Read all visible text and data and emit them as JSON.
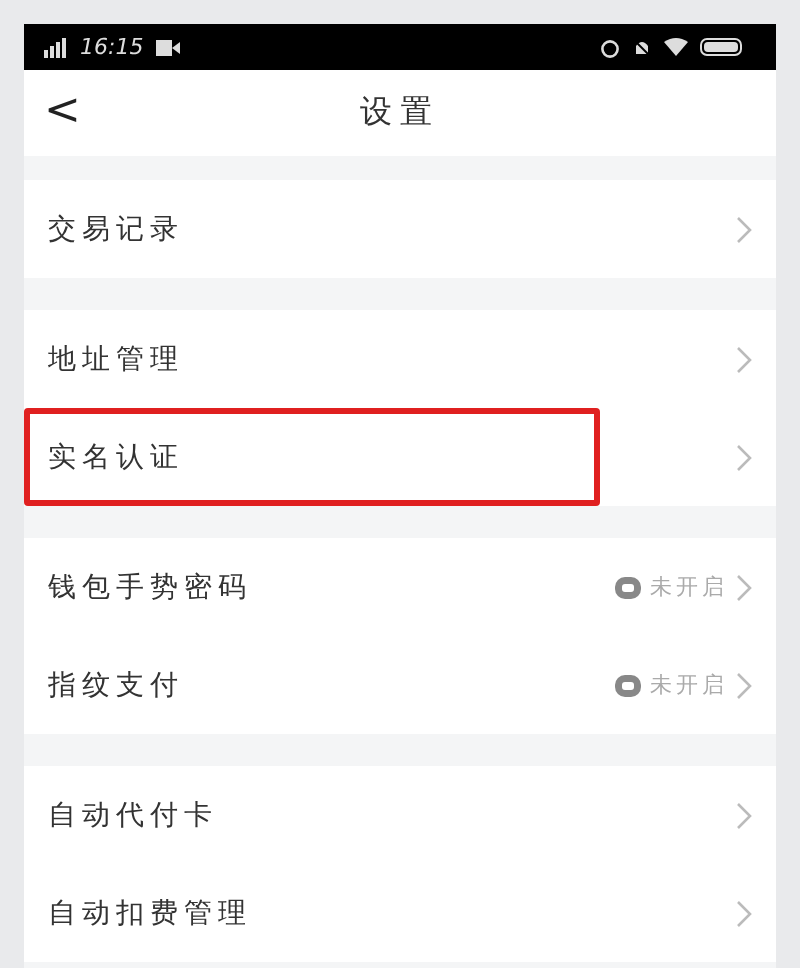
{
  "status_bar": {
    "time": "16:15"
  },
  "nav": {
    "back": "<",
    "title": "设置"
  },
  "groups": [
    {
      "items": [
        {
          "label": "交易记录",
          "highlighted": false
        }
      ]
    },
    {
      "items": [
        {
          "label": "地址管理",
          "highlighted": false
        },
        {
          "label": "实名认证",
          "highlighted": true
        }
      ]
    },
    {
      "items": [
        {
          "label": "钱包手势密码",
          "highlighted": false,
          "status": "未开启"
        },
        {
          "label": "指纹支付",
          "highlighted": false,
          "status": "未开启"
        }
      ]
    },
    {
      "items": [
        {
          "label": "自动代付卡",
          "highlighted": false
        },
        {
          "label": "自动扣费管理",
          "highlighted": false
        }
      ]
    }
  ]
}
